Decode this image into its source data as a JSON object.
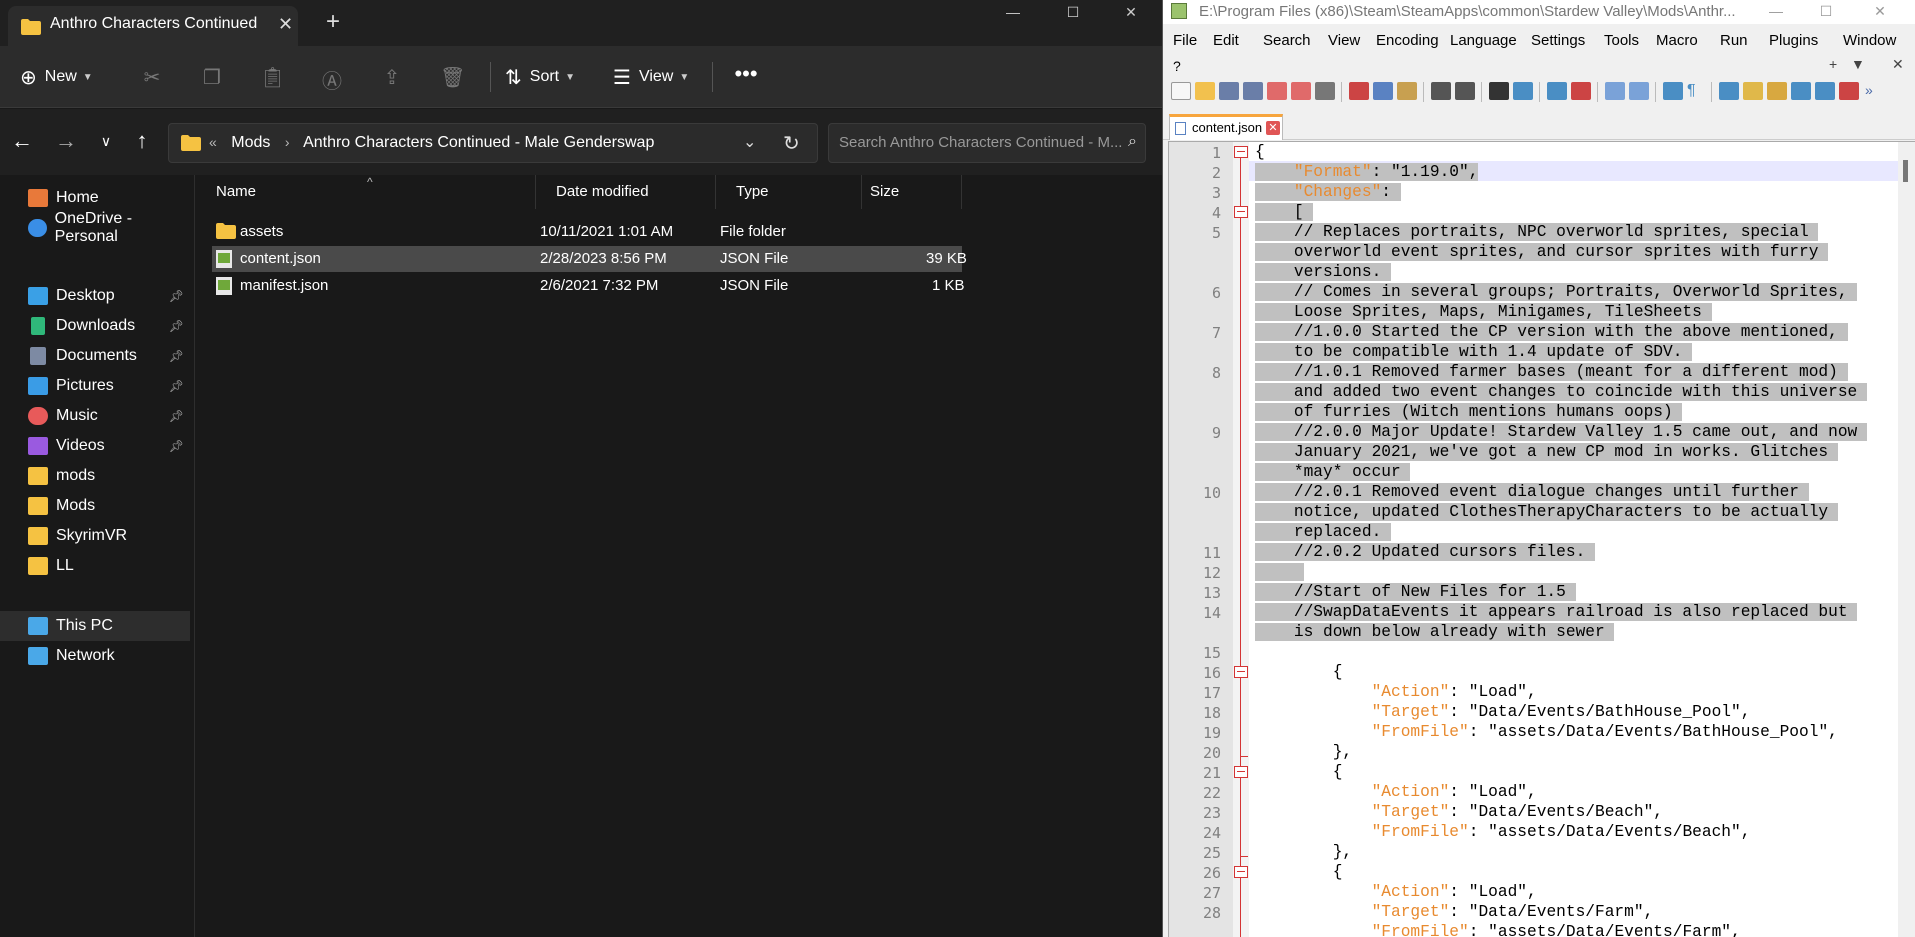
{
  "explorer": {
    "tab_title": "Anthro Characters Continued",
    "commands": {
      "new_label": "New",
      "sort_label": "Sort",
      "view_label": "View"
    },
    "address": {
      "crumb_mods": "Mods",
      "crumb_current": "Anthro Characters Continued - Male Genderswap"
    },
    "search_placeholder": "Search Anthro Characters Continued - M...",
    "sidebar": {
      "home": "Home",
      "onedrive": "OneDrive - Personal",
      "desktop": "Desktop",
      "downloads": "Downloads",
      "documents": "Documents",
      "pictures": "Pictures",
      "music": "Music",
      "videos": "Videos",
      "mods_lower": "mods",
      "mods_upper": "Mods",
      "skyrimvr": "SkyrimVR",
      "ll": "LL",
      "this_pc": "This PC",
      "network": "Network"
    },
    "columns": {
      "name": "Name",
      "date": "Date modified",
      "type": "Type",
      "size": "Size"
    },
    "files": [
      {
        "name": "assets",
        "date": "10/11/2021 1:01 AM",
        "type": "File folder",
        "size": ""
      },
      {
        "name": "content.json",
        "date": "2/28/2023 8:56 PM",
        "type": "JSON File",
        "size": "39 KB"
      },
      {
        "name": "manifest.json",
        "date": "2/6/2021 7:32 PM",
        "type": "JSON File",
        "size": "1 KB"
      }
    ]
  },
  "notepad": {
    "title": "E:\\Program Files (x86)\\Steam\\SteamApps\\common\\Stardew Valley\\Mods\\Anthr...",
    "menu": {
      "file": "File",
      "edit": "Edit",
      "search": "Search",
      "view": "View",
      "encoding": "Encoding",
      "language": "Language",
      "settings": "Settings",
      "tools": "Tools",
      "macro": "Macro",
      "run": "Run",
      "plugins": "Plugins",
      "window": "Window",
      "help": "?"
    },
    "tab_name": "content.json",
    "line_numbers": [
      "1",
      "2",
      "3",
      "4",
      "5",
      "6",
      "7",
      "8",
      "9",
      "10",
      "11",
      "12",
      "13",
      "14",
      "15",
      "16",
      "17",
      "18",
      "19",
      "20",
      "21",
      "22",
      "23",
      "24",
      "25",
      "26",
      "27",
      "28"
    ],
    "code": {
      "l1": "{",
      "l2_key": "\"Format\"",
      "l2_rest": ": \"1.19.0\",",
      "l3_key": "\"Changes\"",
      "l3_rest": ":",
      "l4": "[",
      "l5a": "// Replaces portraits, NPC overworld sprites, special",
      "l5b": "overworld event sprites, and cursor sprites with furry",
      "l5c": "versions.",
      "l6a": "// Comes in several groups; Portraits, Overworld Sprites,",
      "l6b": "Loose Sprites, Maps, Minigames, TileSheets",
      "l7a": "//1.0.0 Started the CP version with the above mentioned,",
      "l7b": "to be compatible with 1.4 update of SDV.",
      "l8a": "//1.0.1 Removed farmer bases (meant for a different mod)",
      "l8b": "and added two event changes to coincide with this universe",
      "l8c": "of furries (Witch mentions humans oops)",
      "l9a": "//2.0.0 Major Update! Stardew Valley 1.5 came out, and now",
      "l9b": "January 2021, we've got a new CP mod in works. Glitches",
      "l9c": "*may* occur",
      "l10a": "//2.0.1 Removed event dialogue changes until further",
      "l10b": "notice, updated ClothesTherapyCharacters to be actually",
      "l10c": "replaced.",
      "l11": "//2.0.2 Updated cursors files.",
      "l13": "//Start of New Files for 1.5",
      "l14a": "//SwapDataEvents it appears railroad is also replaced but",
      "l14b": "is down below already with sewer",
      "open_brace": "{",
      "close_brace": "},",
      "action_key": "\"Action\"",
      "target_key": "\"Target\"",
      "fromfile_key": "\"FromFile\"",
      "load_val": ": \"Load\",",
      "t1": ": \"Data/Events/BathHouse_Pool\",",
      "f1": ": \"assets/Data/Events/BathHouse_Pool\",",
      "t2": ": \"Data/Events/Beach\",",
      "f2": ": \"assets/Data/Events/Beach\",",
      "t3": ": \"Data/Events/Farm\",",
      "f3": ": \"assets/Data/Events/Farm\","
    }
  }
}
